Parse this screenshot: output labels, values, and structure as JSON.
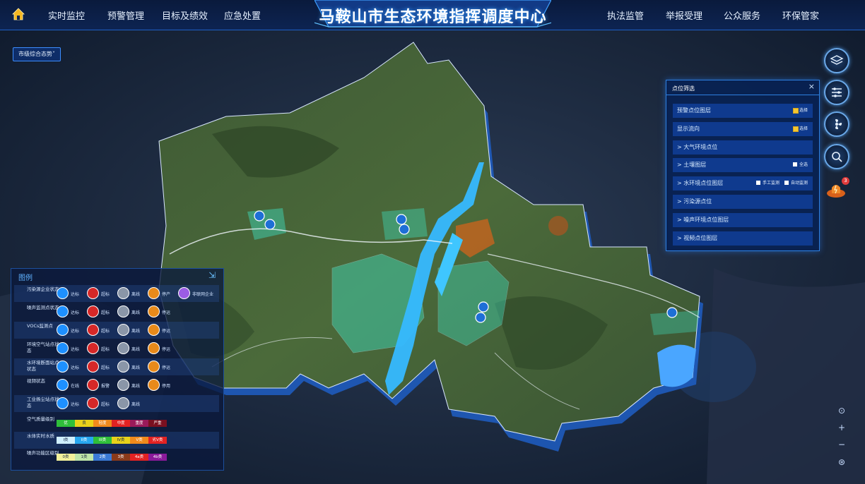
{
  "header": {
    "title": "马鞍山市生态环境指挥调度中心",
    "nav_left": [
      "实时监控",
      "预警管理",
      "目标及绩效",
      "应急处置"
    ],
    "nav_right": [
      "执法监管",
      "举报受理",
      "公众服务",
      "环保管家"
    ]
  },
  "city_select": {
    "label": "市级综合态势"
  },
  "filter_panel": {
    "title": "点位筛选",
    "close_label": "×",
    "rows": [
      {
        "label": "预警点位图层",
        "options": [
          "选择"
        ]
      },
      {
        "label": "显示流向",
        "options": [
          "选择"
        ]
      },
      {
        "label": "> 大气环境点位",
        "options": []
      },
      {
        "label": "> 土壤图层",
        "options": [
          "全选"
        ]
      },
      {
        "label": "> 水环境点位图层",
        "options": [
          "手工监测",
          "自动监测"
        ]
      },
      {
        "label": "> 污染源点位",
        "options": []
      },
      {
        "label": "> 噪声环境点位图层",
        "options": []
      },
      {
        "label": "> 视频点位图层",
        "options": []
      }
    ]
  },
  "alarm": {
    "count": "3"
  },
  "legend": {
    "title": "图例",
    "collapse_label": "⇲",
    "status_rows": [
      {
        "name": "污染源企业状态",
        "items": [
          {
            "label": "达标",
            "color": "#1e90ff"
          },
          {
            "label": "超标",
            "color": "#d62828"
          },
          {
            "label": "离线",
            "color": "#8a96a8"
          },
          {
            "label": "停产",
            "color": "#e88a1a"
          },
          {
            "label": "非联网企业",
            "color": "#9b5de5"
          }
        ]
      },
      {
        "name": "噪声监测点状态",
        "items": [
          {
            "label": "达标",
            "color": "#1e90ff"
          },
          {
            "label": "超标",
            "color": "#d62828"
          },
          {
            "label": "离线",
            "color": "#8a96a8"
          },
          {
            "label": "停运",
            "color": "#e88a1a"
          }
        ]
      },
      {
        "name": "VOCs监测点",
        "items": [
          {
            "label": "达标",
            "color": "#1e90ff"
          },
          {
            "label": "超标",
            "color": "#d62828"
          },
          {
            "label": "离线",
            "color": "#8a96a8"
          },
          {
            "label": "停运",
            "color": "#e88a1a"
          }
        ]
      },
      {
        "name": "环境空气站点状态",
        "items": [
          {
            "label": "达标",
            "color": "#1e90ff"
          },
          {
            "label": "超标",
            "color": "#d62828"
          },
          {
            "label": "离线",
            "color": "#8a96a8"
          },
          {
            "label": "停运",
            "color": "#e88a1a"
          }
        ]
      },
      {
        "name": "水环境断面站点状态",
        "items": [
          {
            "label": "达标",
            "color": "#1e90ff"
          },
          {
            "label": "超标",
            "color": "#d62828"
          },
          {
            "label": "离线",
            "color": "#8a96a8"
          },
          {
            "label": "停运",
            "color": "#e88a1a"
          }
        ]
      },
      {
        "name": "视频状态",
        "items": [
          {
            "label": "在线",
            "color": "#1e90ff"
          },
          {
            "label": "报警",
            "color": "#d62828"
          },
          {
            "label": "离线",
            "color": "#8a96a8"
          },
          {
            "label": "停用",
            "color": "#e88a1a"
          }
        ]
      },
      {
        "name": "工业扬尘站点状态",
        "items": [
          {
            "label": "达标",
            "color": "#1e90ff"
          },
          {
            "label": "超标",
            "color": "#d62828"
          },
          {
            "label": "离线",
            "color": "#8a96a8"
          }
        ]
      }
    ],
    "scale_rows": [
      {
        "name": "空气质量级别",
        "bars": [
          {
            "label": "优",
            "color": "#2fbf3a"
          },
          {
            "label": "良",
            "color": "#e8d21a"
          },
          {
            "label": "轻度",
            "color": "#f08a1c"
          },
          {
            "label": "中度",
            "color": "#e22222"
          },
          {
            "label": "重度",
            "color": "#9a1a5a"
          },
          {
            "label": "严重",
            "color": "#7a1020"
          }
        ]
      },
      {
        "name": "水体实时水质",
        "bars": [
          {
            "label": "I类",
            "color": "#cfefff"
          },
          {
            "label": "II类",
            "color": "#27a7f0"
          },
          {
            "label": "III类",
            "color": "#2fbf3a"
          },
          {
            "label": "IV类",
            "color": "#e8d21a"
          },
          {
            "label": "V类",
            "color": "#f08a1c"
          },
          {
            "label": "劣V类",
            "color": "#e22222"
          }
        ]
      },
      {
        "name": "噪声功能区级别",
        "bars": [
          {
            "label": "0类",
            "color": "#f3f19a"
          },
          {
            "label": "1类",
            "color": "#bfe6a8"
          },
          {
            "label": "2类",
            "color": "#3a7ad6"
          },
          {
            "label": "3类",
            "color": "#8a3a1a"
          },
          {
            "label": "4a类",
            "color": "#e22222"
          },
          {
            "label": "4b类",
            "color": "#8a1a9a"
          }
        ]
      }
    ]
  },
  "zoom": {
    "locate": "⊙",
    "plus": "+",
    "minus": "−",
    "compass": "⊛"
  }
}
